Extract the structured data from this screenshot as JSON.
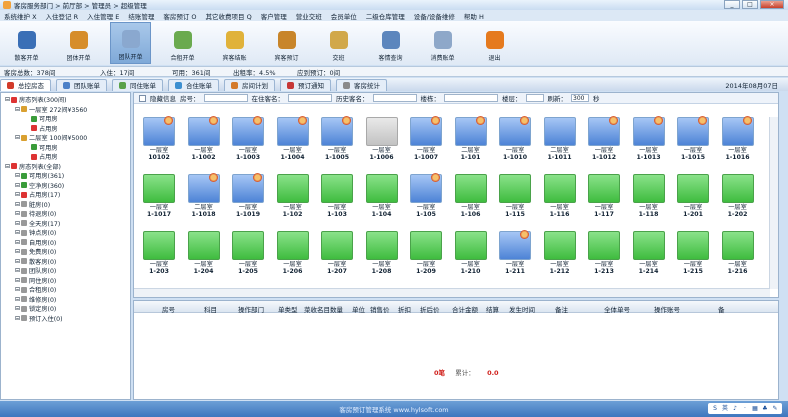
{
  "window": {
    "title": "客房服务部门 > 前厅部 > 管理员 > 超级管理",
    "btn_min": "_",
    "btn_max": "□",
    "btn_close": "×"
  },
  "menu": [
    "系统维护 X",
    "入住登记 R",
    "入住管理 E",
    "结账管理",
    "客房预订 O",
    "其它收费项目 Q",
    "客户管理",
    "营业交班",
    "会员单位",
    "二级仓库管理",
    "设备/设备维修",
    "帮助 H"
  ],
  "toolbar": [
    {
      "label": "散客开单",
      "color": "#3a6fb6"
    },
    {
      "label": "团体开单",
      "color": "#d68d2a"
    },
    {
      "label": "团队开单",
      "color": "#8aa8cf",
      "active": true
    },
    {
      "label": "合租开单",
      "color": "#6aaa4f"
    },
    {
      "label": "宾客结账",
      "color": "#e0b23a"
    },
    {
      "label": "宾客预订",
      "color": "#c8852a"
    },
    {
      "label": "交班",
      "color": "#d1a84a"
    },
    {
      "label": "客情查询",
      "color": "#5c86bd"
    },
    {
      "label": "消费账单",
      "color": "#8ea8c9"
    },
    {
      "label": "退出",
      "color": "#e57a1e"
    }
  ],
  "status": {
    "total": "客房总数：378间",
    "occupied": "入住：17间",
    "available": "可用：361间",
    "rate": "出租率：4.5%",
    "booked": "应到预订：0间"
  },
  "tabs": [
    {
      "label": "总控房态",
      "active": true,
      "color": "#d23b2a"
    },
    {
      "label": "团队账单",
      "color": "#4b80c8"
    },
    {
      "label": "同住账单",
      "color": "#5aa24a"
    },
    {
      "label": "合住账单",
      "color": "#3c8fd0"
    },
    {
      "label": "房间计划",
      "color": "#d47a2a"
    },
    {
      "label": "预订通知",
      "color": "#c63838"
    },
    {
      "label": "客房统计",
      "color": "#8a8a8a"
    }
  ],
  "date": "2014年08月07日",
  "filters": {
    "hidden": "隐藏信息",
    "room_no": "房号：",
    "guest": "在住客名：",
    "history": "历史客名：",
    "building": "楼栋：",
    "floor": "楼层：",
    "refresh": "刷新：",
    "refresh_val": "300",
    "sec": "秒"
  },
  "tree": [
    {
      "t": "房态列表(300间)",
      "i": 0,
      "c": "#d33"
    },
    {
      "t": "一层室 272间¥3560",
      "i": 1,
      "c": "#d9a030"
    },
    {
      "t": "可用房",
      "i": 2,
      "c": "#3a9c3a"
    },
    {
      "t": "占用房",
      "i": 2,
      "c": "#d33"
    },
    {
      "t": "二层室 100间¥5000",
      "i": 1,
      "c": "#d9a030"
    },
    {
      "t": "可用房",
      "i": 2,
      "c": "#3a9c3a"
    },
    {
      "t": "占用房",
      "i": 2,
      "c": "#d33"
    },
    {
      "t": "房态列表(全部)",
      "i": 0,
      "c": "#d33"
    },
    {
      "t": "可用房(361)",
      "i": 1,
      "c": "#3a9c3a"
    },
    {
      "t": "空净房(360)",
      "i": 1,
      "c": "#3a9c3a"
    },
    {
      "t": "占用房(17)",
      "i": 1,
      "c": "#d33"
    },
    {
      "t": "脏房(0)",
      "i": 1,
      "c": "#999"
    },
    {
      "t": "待退房(0)",
      "i": 1,
      "c": "#999"
    },
    {
      "t": "全天房(17)",
      "i": 1,
      "c": "#999"
    },
    {
      "t": "钟点房(0)",
      "i": 1,
      "c": "#999"
    },
    {
      "t": "自用房(0)",
      "i": 1,
      "c": "#999"
    },
    {
      "t": "免费房(0)",
      "i": 1,
      "c": "#999"
    },
    {
      "t": "散客房(0)",
      "i": 1,
      "c": "#999"
    },
    {
      "t": "团队房(0)",
      "i": 1,
      "c": "#999"
    },
    {
      "t": "同住房(0)",
      "i": 1,
      "c": "#999"
    },
    {
      "t": "合租房(0)",
      "i": 1,
      "c": "#999"
    },
    {
      "t": "维修房(0)",
      "i": 1,
      "c": "#999"
    },
    {
      "t": "锁定房(0)",
      "i": 1,
      "c": "#999"
    },
    {
      "t": "预订入住(0)",
      "i": 1,
      "c": "#999"
    }
  ],
  "rooms": [
    [
      "blue",
      1,
      "一层室",
      "10102"
    ],
    [
      "blue",
      1,
      "一层室",
      "1-1002"
    ],
    [
      "blue",
      1,
      "一层室",
      "1-1003"
    ],
    [
      "blue",
      1,
      "一层室",
      "1-1004"
    ],
    [
      "blue",
      1,
      "一层室",
      "1-1005"
    ],
    [
      "gray",
      0,
      "一层室",
      "1-1006"
    ],
    [
      "blue",
      1,
      "一层室",
      "1-1007"
    ],
    [
      "blue",
      1,
      "二层室",
      "1-101"
    ],
    [
      "blue",
      1,
      "一层室",
      "1-1010"
    ],
    [
      "blue",
      0,
      "二层室",
      "1-1011"
    ],
    [
      "blue",
      1,
      "一层室",
      "1-1012"
    ],
    [
      "blue",
      1,
      "一层室",
      "1-1013"
    ],
    [
      "blue",
      1,
      "一层室",
      "1-1015"
    ],
    [
      "blue",
      1,
      "一层室",
      "1-1016"
    ],
    [
      "green",
      0,
      "一层室",
      "1-1017"
    ],
    [
      "blue",
      1,
      "二层室",
      "1-1018"
    ],
    [
      "blue",
      1,
      "一层室",
      "1-1019"
    ],
    [
      "green",
      0,
      "一层室",
      "1-102"
    ],
    [
      "green",
      0,
      "一层室",
      "1-103"
    ],
    [
      "green",
      0,
      "一层室",
      "1-104"
    ],
    [
      "blue",
      1,
      "一层室",
      "1-105"
    ],
    [
      "green",
      0,
      "一层室",
      "1-106"
    ],
    [
      "green",
      0,
      "一层室",
      "1-115"
    ],
    [
      "green",
      0,
      "一层室",
      "1-116"
    ],
    [
      "green",
      0,
      "一层室",
      "1-117"
    ],
    [
      "green",
      0,
      "一层室",
      "1-118"
    ],
    [
      "green",
      0,
      "一层室",
      "1-201"
    ],
    [
      "green",
      0,
      "一层室",
      "1-202"
    ],
    [
      "green",
      0,
      "一层室",
      "1-203"
    ],
    [
      "green",
      0,
      "一层室",
      "1-204"
    ],
    [
      "green",
      0,
      "一层室",
      "1-205"
    ],
    [
      "green",
      0,
      "一层室",
      "1-206"
    ],
    [
      "green",
      0,
      "一层室",
      "1-207"
    ],
    [
      "green",
      0,
      "一层室",
      "1-208"
    ],
    [
      "green",
      0,
      "一层室",
      "1-209"
    ],
    [
      "green",
      0,
      "一层室",
      "1-210"
    ],
    [
      "blue",
      1,
      "一层室",
      "1-211"
    ],
    [
      "green",
      0,
      "一层室",
      "1-212"
    ],
    [
      "green",
      0,
      "一层室",
      "1-213"
    ],
    [
      "green",
      0,
      "一层室",
      "1-214"
    ],
    [
      "green",
      0,
      "一层室",
      "1-215"
    ],
    [
      "green",
      0,
      "一层室",
      "1-216"
    ]
  ],
  "table_headers": [
    "房号",
    "科目",
    "操作部门",
    "单类型",
    "菜收名目",
    "数量",
    "单位",
    "销售价",
    "折扣",
    "折后价",
    "合计金额",
    "结算",
    "发生时间",
    "备注",
    "全体单号",
    "操作账号",
    "备"
  ],
  "totals": {
    "count": "0笔",
    "label": "累计：",
    "amount": "0.0"
  },
  "footer": "客房预订管理系统 www.hylsoft.com",
  "tray": [
    "S",
    "英",
    "♪",
    "·",
    "▦",
    "♣",
    "✎"
  ]
}
